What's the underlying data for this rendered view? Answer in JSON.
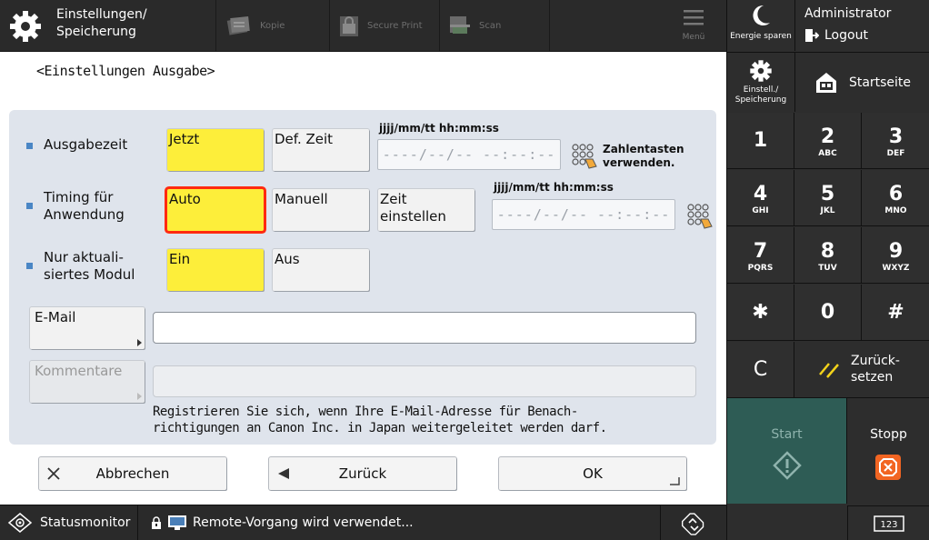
{
  "header": {
    "title_line1": "Einstellungen/",
    "title_line2": "Speicherung",
    "functions": [
      {
        "label": "Kopie",
        "icon": "copy-icon"
      },
      {
        "label": "Secure Print",
        "icon": "lock-icon"
      },
      {
        "label": "Scan",
        "icon": "scan-icon"
      }
    ],
    "menu_label": "Menü"
  },
  "right_panel": {
    "energy_label": "Energie sparen",
    "user": "Administrator",
    "logout_label": "Logout",
    "settings_line1": "Einstell./",
    "settings_line2": "Speicherung",
    "home_label": "Startseite",
    "keys": [
      {
        "digit": "1",
        "letters": ""
      },
      {
        "digit": "2",
        "letters": "ABC"
      },
      {
        "digit": "3",
        "letters": "DEF"
      },
      {
        "digit": "4",
        "letters": "GHI"
      },
      {
        "digit": "5",
        "letters": "JKL"
      },
      {
        "digit": "6",
        "letters": "MNO"
      },
      {
        "digit": "7",
        "letters": "PQRS"
      },
      {
        "digit": "8",
        "letters": "TUV"
      },
      {
        "digit": "9",
        "letters": "WXYZ"
      },
      {
        "digit": "✱",
        "letters": ""
      },
      {
        "digit": "0",
        "letters": ""
      },
      {
        "digit": "#",
        "letters": ""
      },
      {
        "digit": "C",
        "letters": ""
      }
    ],
    "reset_line1": "Zurück-",
    "reset_line2": "setzen",
    "start_label": "Start",
    "stop_label": "Stopp",
    "keyboard_label": "123"
  },
  "page": {
    "title": "<Einstellungen Ausgabe>",
    "rows": {
      "ausgabezeit": {
        "label": "Ausgabezeit",
        "opt_now": "Jetzt",
        "opt_def": "Def. Zeit",
        "dt_label": "jjjj/mm/tt hh:mm:ss",
        "dt_value": "----/--/-- --:--:--",
        "hint_line1": "Zahlentasten",
        "hint_line2": "verwenden."
      },
      "timing": {
        "label_line1": "Timing für",
        "label_line2": "Anwendung",
        "opt_auto": "Auto",
        "opt_manual": "Manuell",
        "opt_set_line1": "Zeit",
        "opt_set_line2": "einstellen",
        "dt_label": "jjjj/mm/tt hh:mm:ss",
        "dt_value": "----/--/-- --:--:--"
      },
      "modul": {
        "label_line1": "Nur aktuali-",
        "label_line2": "siertes Modul",
        "opt_on": "Ein",
        "opt_off": "Aus"
      }
    },
    "email_label": "E-Mail",
    "email_value": "",
    "comment_label": "Kommentare",
    "comment_value": "",
    "info_line1": "Registrieren Sie sich, wenn Ihre E-Mail-Adresse für Benach-",
    "info_line2": "richtigungen an Canon Inc. in Japan weitergeleitet werden darf.",
    "cancel_label": "Abbrechen",
    "back_label": "Zurück",
    "ok_label": "OK"
  },
  "statusbar": {
    "monitor_label": "Statusmonitor",
    "message": "Remote-Vorgang wird verwendet..."
  },
  "colors": {
    "selected": "#fdee3a",
    "focus": "#ff2a10",
    "start": "#2e5c55",
    "stop": "#f26522",
    "bullet": "#4a86c5"
  }
}
